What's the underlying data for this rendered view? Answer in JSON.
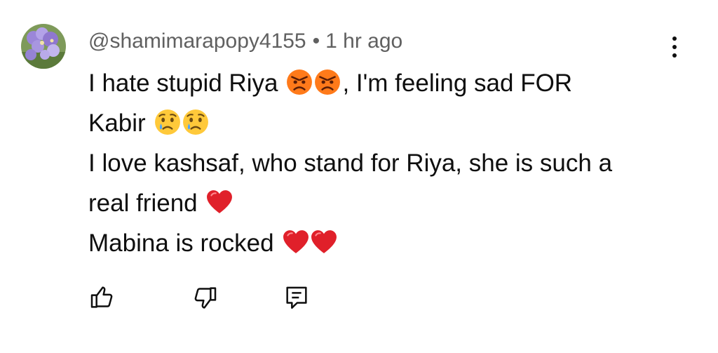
{
  "comment": {
    "author": "@shamimarapopy4155",
    "separator": "•",
    "timestamp": "1 hr ago",
    "avatar_icon": "flower-photo-avatar",
    "lines": [
      {
        "parts": [
          {
            "text": "I hate stupid Riya"
          },
          {
            "emoji": "angry-face-icon"
          },
          {
            "emoji": "angry-face-icon"
          },
          {
            "text": ", I'm feeling sad FOR"
          }
        ]
      },
      {
        "parts": [
          {
            "text": "Kabir"
          },
          {
            "emoji": "crying-face-icon"
          },
          {
            "emoji": "crying-face-icon"
          }
        ]
      },
      {
        "parts": [
          {
            "text": "I love kashsaf, who stand for Riya, she is such a"
          }
        ]
      },
      {
        "parts": [
          {
            "text": "real friend"
          },
          {
            "emoji": "red-heart-icon"
          }
        ]
      },
      {
        "parts": [
          {
            "text": "Mabina is rocked"
          },
          {
            "emoji": "red-heart-icon"
          },
          {
            "emoji": "red-heart-icon"
          }
        ]
      }
    ]
  },
  "actions": {
    "like_icon": "thumbs-up-icon",
    "dislike_icon": "thumbs-down-icon",
    "reply_icon": "reply-comment-icon",
    "menu_icon": "more-vert-icon"
  },
  "colors": {
    "text": "#0f0f0f",
    "meta": "#606060",
    "heart": "#e0202a",
    "angry_face": "#ff7a1a",
    "crying_face": "#ffc93a",
    "tear": "#4aa3ff"
  }
}
